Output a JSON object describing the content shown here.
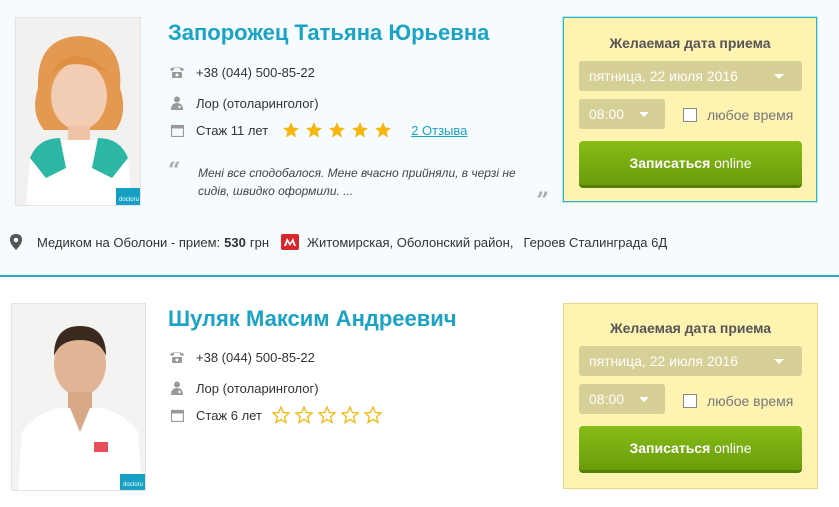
{
  "doctors": [
    {
      "name": "Запорожец Татьяна Юрьевна",
      "phone": "+38 (044) 500-85-22",
      "specialty": "Лор (отоларинголог)",
      "experience": "Стаж 11 лет",
      "rating": 5,
      "reviews_link": "2 Отзыва",
      "review_text": "Мені все сподобалося. Мене вчасно прийняли, в черзі не сидів, швидко оформили. ...",
      "photo_badge": "doctoru",
      "clinic_prefix": "Медиком на Оболони - прием:",
      "price": "530",
      "price_unit": "грн",
      "metro": "Житомирская, Оболонский район,",
      "address": "Героев Сталинграда 6Д",
      "booking": {
        "title": "Желаемая дата приема",
        "date": "пятница, 22 июля 2016",
        "time": "08:00",
        "any_time_label": "любое время",
        "button_bold": "Записаться",
        "button_light": "online"
      }
    },
    {
      "name": "Шуляк Максим Андреевич",
      "phone": "+38 (044) 500-85-22",
      "specialty": "Лор (отоларинголог)",
      "experience": "Стаж 6 лет",
      "rating": 0,
      "photo_badge": "doctoru",
      "booking": {
        "title": "Желаемая дата приема",
        "date": "пятница, 22 июля 2016",
        "time": "08:00",
        "any_time_label": "любое время",
        "button_bold": "Записаться",
        "button_light": "online"
      }
    }
  ],
  "icons": [
    "phone-icon",
    "doctor-icon",
    "calendar-icon",
    "star-icon",
    "quote-icon",
    "map-pin-icon",
    "metro-icon",
    "chevron-down-icon"
  ],
  "colors": {
    "accent": "#1ba3c6",
    "star": "#f5b70d",
    "button": "#7ab310",
    "booking_bg": "#fff3b2",
    "select_bg": "#d6cf96",
    "metro": "#d9262a"
  }
}
